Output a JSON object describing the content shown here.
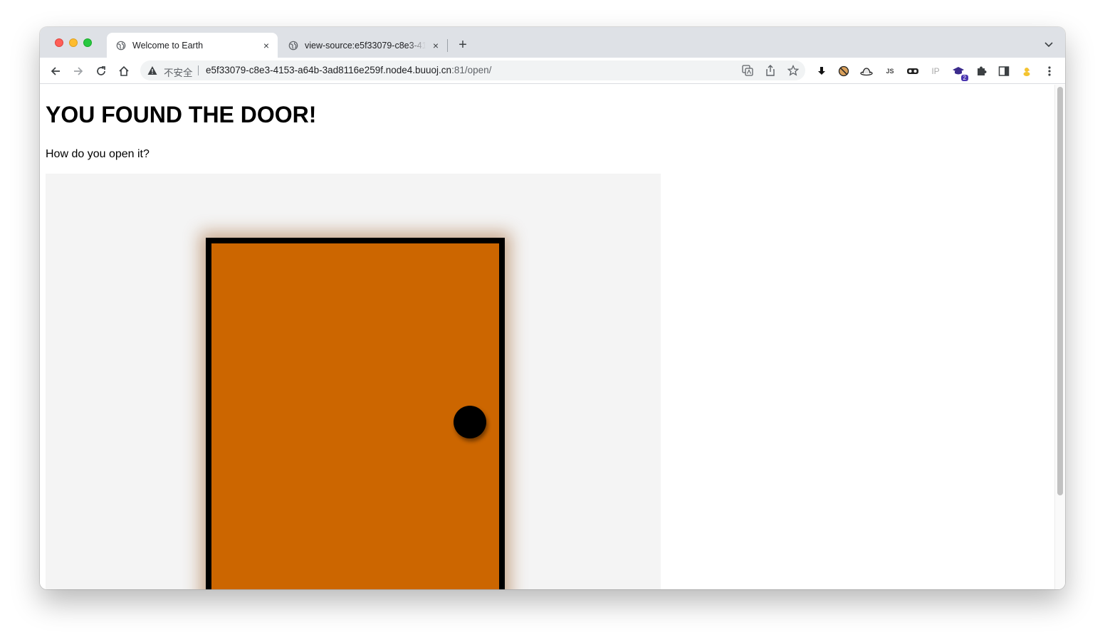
{
  "browser": {
    "tabs": [
      {
        "title": "Welcome to Earth",
        "active": true
      },
      {
        "title": "view-source:e5f33079-c8e3-4153",
        "active": false
      }
    ],
    "new_tab_symbol": "+",
    "close_symbol": "×",
    "address": {
      "security_label": "不安全",
      "url_host": "e5f33079-c8e3-4153-a64b-3ad8116e259f.node4.buuoj.cn",
      "url_rest": ":81/open/"
    },
    "extensions": {
      "ip_label": "IP",
      "js_label": "JS",
      "badge_count": "2"
    }
  },
  "page": {
    "heading": "YOU FOUND THE DOOR!",
    "prompt": "How do you open it?"
  },
  "colors": {
    "door": "#cc6600",
    "frame": "#000000",
    "stage_bg": "#f4f4f4"
  }
}
